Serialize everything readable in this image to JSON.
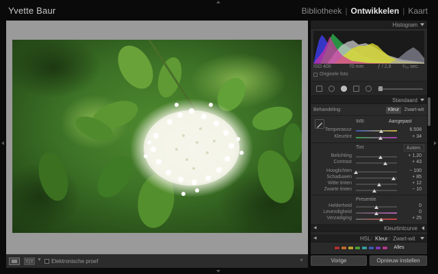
{
  "owner_name": "Yvette Baur",
  "modules": [
    "Bibliotheek",
    "Ontwikkelen",
    "Kaart"
  ],
  "active_module": "Ontwikkelen",
  "histogram": {
    "title": "Histogram",
    "iso": "ISO 400",
    "focal": "70 mm",
    "aperture": "ƒ / 2,8",
    "shutter": "¹⁄₃₀ sec.",
    "original_label": "Originele foto"
  },
  "basic": {
    "title": "Standaard",
    "treatment_label": "Behandeling:",
    "treatment_color": "Kleur",
    "treatment_bw": "Zwart-wit",
    "wb_label": "WB:",
    "wb_value": "Aangepast",
    "temp_label": "Temperatuur",
    "temp_value": "6.508",
    "temp_level": 0.62,
    "tint_label": "Kleurtint",
    "tint_value": "+ 34",
    "tint_level": 0.6,
    "tone_title": "Tint",
    "auto_label": "Autom.",
    "exposure_label": "Belichting",
    "exposure_value": "+ 1,20",
    "exposure_level": 0.6,
    "contrast_label": "Contrast",
    "contrast_value": "+ 43",
    "contrast_level": 0.71,
    "highlights_label": "Hooglichten",
    "highlights_value": "− 100",
    "highlights_level": 0.0,
    "shadows_label": "Schaduwen",
    "shadows_value": "+ 85",
    "shadows_level": 0.92,
    "whites_label": "Witte tinten",
    "whites_value": "+ 12",
    "whites_level": 0.56,
    "blacks_label": "Zwarte tinten",
    "blacks_value": "− 10",
    "blacks_level": 0.45,
    "presence_title": "Presentie",
    "clarity_label": "Helderheid",
    "clarity_value": "0",
    "clarity_level": 0.5,
    "vibrance_label": "Levendigheid",
    "vibrance_value": "0",
    "vibrance_level": 0.5,
    "saturation_label": "Verzadiging",
    "saturation_value": "+ 25",
    "saturation_level": 0.62
  },
  "tone_curve": {
    "title": "Kleurtintcurve"
  },
  "hsl": {
    "hsl_label": "HSL",
    "color_label": "Kleur",
    "bw_label": "Zwart-wit",
    "all_label": "Alles",
    "swatch_colors": [
      "#b03030",
      "#c06a2a",
      "#b8a030",
      "#4f9a3a",
      "#3a9a9a",
      "#3a5ab0",
      "#7a3ab0",
      "#b03a8a"
    ]
  },
  "bottom": {
    "previous_label": "Vorige",
    "reset_label": "Opnieuw instellen"
  },
  "toolbar": {
    "soft_proof_label": "Elektronische proef"
  },
  "colors": {
    "panel_bg": "#2a2a2a",
    "photo_bg": "#9a9a9a",
    "active_text": "#e8e8e8"
  }
}
